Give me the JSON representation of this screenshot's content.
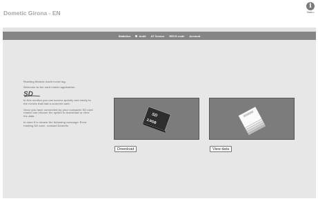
{
  "header": {
    "app_title": "Dometic Girona - EN",
    "info_label": "Stats.u"
  },
  "nav": {
    "items": [
      "Statistics",
      "Audit",
      "AT Sensor",
      "RECG code",
      "Account"
    ]
  },
  "content": {
    "intro": "Reading Module Audit event log.",
    "welcome": "Welcome to the card reader application",
    "logo_text": "SD",
    "p1": "In this section you can access quickly and easily to the events that had a concrete safe.",
    "p2": "Once you have connected by your computer SD card reader can choose the option to download or view the data.",
    "p3": "In case it is shown the following message: Error reading SD card , contact Dometic.",
    "sd_card_text": "2.0GB"
  },
  "buttons": {
    "download": "Download",
    "view_data": "View data"
  },
  "colors": {
    "nav_bg": "#858585",
    "frame_bg": "#e2e2e2",
    "text": "#8c8c8c"
  }
}
